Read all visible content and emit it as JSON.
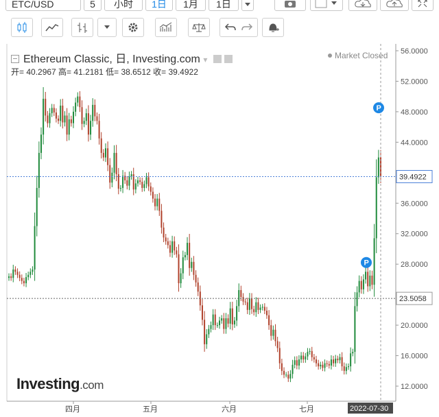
{
  "toolbar": {
    "symbol": "ETC/USD",
    "interval_value": "5",
    "interval_unit": "小时",
    "period_day": "1日",
    "period_month": "1月",
    "period_day2": "1日"
  },
  "chart_data": {
    "type": "candlestick",
    "title": "Ethereum Classic, 日, Investing.com",
    "ohlc_readout": "开= 40.2967 高= 41.2181 低= 38.6512 收= 39.4922",
    "status": "Market Closed",
    "y_ticks": [
      "12.0000",
      "16.0000",
      "20.0000",
      "24.0000",
      "28.0000",
      "32.0000",
      "36.0000",
      "40.0000",
      "44.0000",
      "48.0000",
      "52.0000",
      "56.0000"
    ],
    "ylim": [
      10.2,
      57.2
    ],
    "x_ticks": [
      "四月",
      "五月",
      "六月",
      "七月"
    ],
    "x_last_label": "2022-07-30",
    "price_current": "39.4922",
    "price_level": "23.5058",
    "markers": [
      "P",
      "P"
    ],
    "colors": {
      "up": "#1f8a3b",
      "down": "#b0412b",
      "current_line": "#4a7fd8",
      "level_line": "#666666",
      "marker": "#1e88e5"
    },
    "close": [
      26.4,
      26.2,
      27.3,
      27.0,
      26.6,
      26.2,
      25.8,
      25.5,
      26.3,
      26.6,
      27.0,
      27.3,
      33.0,
      38.0,
      42.6,
      45.0,
      49.7,
      47.5,
      46.5,
      47.8,
      48.5,
      47.9,
      47.1,
      46.8,
      48.8,
      46.6,
      47.5,
      45.0,
      47.0,
      46.5,
      48.0,
      49.2,
      50.0,
      48.6,
      46.4,
      46.8,
      47.8,
      45.0,
      46.8,
      48.9,
      47.4,
      46.8,
      44.5,
      42.6,
      42.0,
      43.2,
      41.0,
      38.7,
      40.0,
      42.6,
      39.8,
      37.9,
      38.0,
      39.6,
      39.0,
      38.3,
      39.5,
      39.8,
      37.8,
      38.6,
      39.0,
      38.8,
      38.0,
      38.5,
      39.4,
      38.2,
      37.5,
      36.6,
      35.6,
      36.6,
      35.0,
      32.8,
      31.5,
      31.0,
      30.5,
      29.5,
      31.0,
      29.8,
      29.3,
      25.5,
      26.8,
      28.9,
      29.2,
      30.8,
      27.5,
      28.3,
      26.6,
      25.6,
      24.4,
      22.6,
      20.7,
      17.5,
      18.8,
      19.5,
      20.0,
      21.4,
      20.0,
      20.0,
      20.6,
      20.9,
      19.5,
      20.9,
      20.2,
      22.2,
      20.1,
      20.6,
      22.5,
      24.6,
      23.7,
      23.1,
      23.0,
      22.0,
      23.5,
      22.1,
      21.7,
      23.0,
      22.0,
      22.3,
      22.4,
      21.9,
      21.3,
      20.0,
      18.6,
      19.4,
      17.9,
      17.0,
      15.0,
      14.0,
      13.5,
      13.5,
      13.0,
      13.6,
      14.8,
      15.4,
      14.7,
      15.5,
      16.0,
      15.5,
      15.9,
      16.5,
      16.6,
      15.8,
      15.5,
      15.0,
      14.6,
      14.8,
      14.4,
      15.0,
      14.9,
      14.7,
      15.5,
      15.0,
      15.6,
      15.4,
      15.8,
      14.6,
      14.0,
      14.5,
      14.6,
      16.3,
      16.5,
      22.5,
      24.3,
      25.8,
      24.7,
      26.0,
      27.0,
      25.1,
      26.5,
      25.3,
      31.4,
      39.4,
      42.0,
      39.49
    ]
  }
}
